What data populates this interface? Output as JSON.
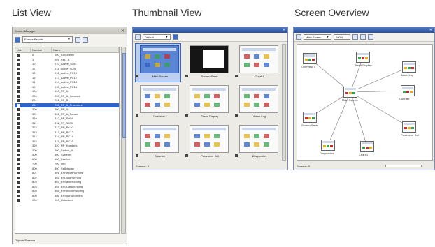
{
  "headings": {
    "list": "List View",
    "thumbnail": "Thumbnail View",
    "overview": "Screen Overview"
  },
  "list_view": {
    "title": "Screen Manager",
    "combo_value": "Ensure Results",
    "columns": [
      "Use",
      "Number",
      "Name"
    ],
    "rows": [
      {
        "number": "0",
        "name": "000_CdiScreen"
      },
      {
        "number": "1",
        "name": "001_SEL_A"
      },
      {
        "number": "10",
        "name": "010_Active_S004"
      },
      {
        "number": "11",
        "name": "011_Active_S008"
      },
      {
        "number": "12",
        "name": "012_Active_PC10"
      },
      {
        "number": "13",
        "name": "013_Active_PC12"
      },
      {
        "number": "14",
        "name": "014_Active_PC14"
      },
      {
        "number": "15",
        "name": "015_Active_PC16"
      },
      {
        "number": "100",
        "name": "100_RP_A"
      },
      {
        "number": "200",
        "name": "200_RP_A_Handshk"
      },
      {
        "number": "201",
        "name": "201_RP_B"
      },
      {
        "number": "202",
        "name": "202_RP_A_Procedure",
        "selected": true
      },
      {
        "number": "300",
        "name": "300_RP_A"
      },
      {
        "number": "301",
        "name": "301_RP_A_Param"
      },
      {
        "number": "310",
        "name": "310_RP_S004"
      },
      {
        "number": "311",
        "name": "311_RP_S008"
      },
      {
        "number": "312",
        "name": "312_RP_PC10"
      },
      {
        "number": "313",
        "name": "313_RP_PC12"
      },
      {
        "number": "314",
        "name": "314_RP_PC14"
      },
      {
        "number": "315",
        "name": "315_RP_PC16"
      },
      {
        "number": "320",
        "name": "320_RP_Handshk"
      },
      {
        "number": "400",
        "name": "400_Station_A"
      },
      {
        "number": "500",
        "name": "500_Systems"
      },
      {
        "number": "600",
        "name": "600_Service"
      },
      {
        "number": "700",
        "name": "700_Info"
      },
      {
        "number": "800",
        "name": "800_SetDisplay"
      },
      {
        "number": "801",
        "name": "801_ErrReportRunning"
      },
      {
        "number": "802",
        "name": "802_ErrLoadRunning"
      },
      {
        "number": "803",
        "name": "803_ErrSaveRunning"
      },
      {
        "number": "804",
        "name": "804_ErrGuardRunning"
      },
      {
        "number": "805",
        "name": "805_ErrRecordRunning"
      },
      {
        "number": "806",
        "name": "806_ErrSoundRunning"
      },
      {
        "number": "900",
        "name": "900_Unlocked"
      }
    ],
    "status": "Objects/Screens"
  },
  "thumbnail_view": {
    "combo_value": "Default",
    "thumbnails": [
      {
        "label": "Main Screen",
        "selected": true
      },
      {
        "label": "Screen Saver",
        "dark": true
      },
      {
        "label": "Chart 1"
      },
      {
        "label": "Overview 1"
      },
      {
        "label": "Trend Display"
      },
      {
        "label": "Alarm Log"
      },
      {
        "label": "Counter"
      },
      {
        "label": "Parameter Set"
      },
      {
        "label": "Diagnostics"
      }
    ],
    "status": "Screens: 9"
  },
  "overview": {
    "combo_value": "Main Screen",
    "zoom_value": "100%",
    "node_labels": [
      "Overview 1",
      "Trend Display",
      "Main Screen",
      "Alarm Log",
      "Counter",
      "Parameter Set",
      "Diagnostics",
      "Chart 1",
      "Screen Saver"
    ],
    "status": "Screens: 9"
  }
}
